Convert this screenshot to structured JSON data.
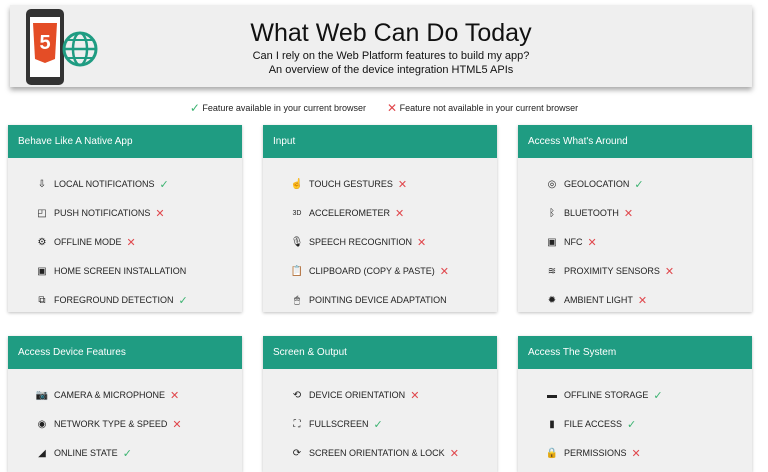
{
  "header": {
    "title": "What Web Can Do Today",
    "subtitle1": "Can I rely on the Web Platform features to build my app?",
    "subtitle2": "An overview of the device integration HTML5 APIs",
    "logo_text": "5"
  },
  "legend": {
    "available": "Feature available in your current browser",
    "unavailable": "Feature not available in your current browser"
  },
  "colors": {
    "accent": "#1f9c82",
    "ok": "#3cb371",
    "no": "#e0474c",
    "html5": "#e44d26"
  },
  "sections": [
    {
      "title": "Behave Like A Native App",
      "items": [
        {
          "label": "LOCAL NOTIFICATIONS",
          "icon": "notification-icon",
          "glyph": "⇩",
          "status": "ok"
        },
        {
          "label": "PUSH NOTIFICATIONS",
          "icon": "cast-icon",
          "glyph": "◰",
          "status": "no"
        },
        {
          "label": "OFFLINE MODE",
          "icon": "offline-icon",
          "glyph": "⚙",
          "status": "no"
        },
        {
          "label": "HOME SCREEN INSTALLATION",
          "icon": "install-icon",
          "glyph": "▣",
          "status": "none"
        },
        {
          "label": "FOREGROUND DETECTION",
          "icon": "foreground-icon",
          "glyph": "⧉",
          "status": "ok"
        }
      ]
    },
    {
      "title": "Input",
      "items": [
        {
          "label": "TOUCH GESTURES",
          "icon": "touch-icon",
          "glyph": "☝",
          "status": "no"
        },
        {
          "label": "ACCELEROMETER",
          "icon": "accelerometer-icon",
          "glyph": "3D",
          "status": "no"
        },
        {
          "label": "SPEECH RECOGNITION",
          "icon": "microphone-icon",
          "glyph": "🎙",
          "status": "no"
        },
        {
          "label": "CLIPBOARD (COPY & PASTE)",
          "icon": "clipboard-icon",
          "glyph": "📋",
          "status": "no"
        },
        {
          "label": "POINTING DEVICE ADAPTATION",
          "icon": "mouse-icon",
          "glyph": "🖱",
          "status": "none"
        }
      ]
    },
    {
      "title": "Access What's Around",
      "items": [
        {
          "label": "GEOLOCATION",
          "icon": "geolocation-icon",
          "glyph": "◎",
          "status": "ok"
        },
        {
          "label": "BLUETOOTH",
          "icon": "bluetooth-icon",
          "glyph": "ᛒ",
          "status": "no"
        },
        {
          "label": "NFC",
          "icon": "nfc-icon",
          "glyph": "▣",
          "status": "no"
        },
        {
          "label": "PROXIMITY SENSORS",
          "icon": "proximity-icon",
          "glyph": "≋",
          "status": "no"
        },
        {
          "label": "AMBIENT LIGHT",
          "icon": "light-icon",
          "glyph": "✹",
          "status": "no"
        }
      ]
    },
    {
      "title": "Access Device Features",
      "items": [
        {
          "label": "CAMERA & MICROPHONE",
          "icon": "camera-icon",
          "glyph": "📷",
          "status": "no"
        },
        {
          "label": "NETWORK TYPE & SPEED",
          "icon": "wifi-icon",
          "glyph": "◉",
          "status": "no"
        },
        {
          "label": "ONLINE STATE",
          "icon": "signal-icon",
          "glyph": "◢",
          "status": "ok"
        }
      ]
    },
    {
      "title": "Screen & Output",
      "items": [
        {
          "label": "DEVICE ORIENTATION",
          "icon": "orientation-icon",
          "glyph": "⟲",
          "status": "no"
        },
        {
          "label": "FULLSCREEN",
          "icon": "fullscreen-icon",
          "glyph": "⛶",
          "status": "ok"
        },
        {
          "label": "SCREEN ORIENTATION & LOCK",
          "icon": "screen-rotation-icon",
          "glyph": "⟳",
          "status": "no"
        }
      ]
    },
    {
      "title": "Access The System",
      "items": [
        {
          "label": "OFFLINE STORAGE",
          "icon": "storage-icon",
          "glyph": "▬",
          "status": "ok"
        },
        {
          "label": "FILE ACCESS",
          "icon": "file-icon",
          "glyph": "▮",
          "status": "ok"
        },
        {
          "label": "PERMISSIONS",
          "icon": "lock-icon",
          "glyph": "🔒",
          "status": "no"
        }
      ]
    }
  ]
}
